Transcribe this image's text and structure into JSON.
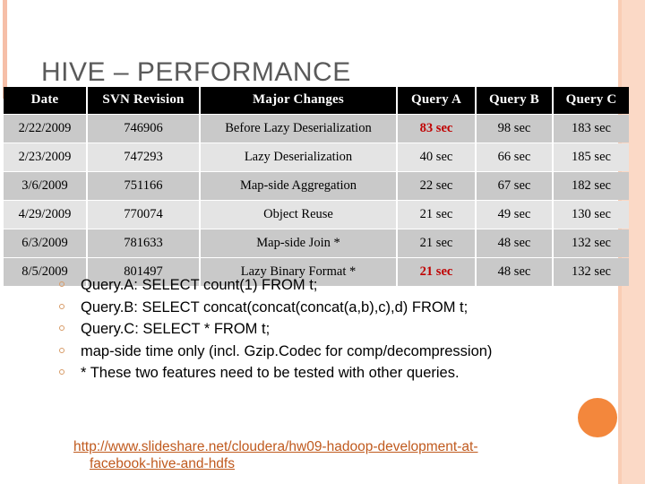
{
  "slide": {
    "title": "HIVE – PERFORMANCE"
  },
  "table": {
    "headers": [
      "Date",
      "SVN Revision",
      "Major Changes",
      "Query A",
      "Query B",
      "Query C"
    ],
    "rows": [
      {
        "date": "2/22/2009",
        "revision": "746906",
        "changes": "Before Lazy Deserialization",
        "query_a": "83 sec",
        "query_b": "98 sec",
        "query_c": "183 sec",
        "highlight_a": true
      },
      {
        "date": "2/23/2009",
        "revision": "747293",
        "changes": "Lazy Deserialization",
        "query_a": "40 sec",
        "query_b": "66 sec",
        "query_c": "185 sec",
        "highlight_a": false
      },
      {
        "date": "3/6/2009",
        "revision": "751166",
        "changes": "Map-side Aggregation",
        "query_a": "22 sec",
        "query_b": "67 sec",
        "query_c": "182 sec",
        "highlight_a": false
      },
      {
        "date": "4/29/2009",
        "revision": "770074",
        "changes": "Object Reuse",
        "query_a": "21 sec",
        "query_b": "49 sec",
        "query_c": "130 sec",
        "highlight_a": false
      },
      {
        "date": "6/3/2009",
        "revision": "781633",
        "changes": "Map-side Join *",
        "query_a": "21 sec",
        "query_b": "48 sec",
        "query_c": "132 sec",
        "highlight_a": false
      },
      {
        "date": "8/5/2009",
        "revision": "801497",
        "changes": "Lazy Binary Format *",
        "query_a": "21 sec",
        "query_b": "48 sec",
        "query_c": "132 sec",
        "highlight_a": true
      }
    ]
  },
  "bullets": [
    "Query.A: SELECT count(1) FROM t;",
    "Query.B: SELECT concat(concat(concat(a,b),c),d) FROM t;",
    "Query.C: SELECT * FROM t;",
    "map-side time only (incl. Gzip.Codec for comp/decompression)",
    "* These two features need to be tested with other queries."
  ],
  "link": {
    "line1": "http://www.slideshare.net/cloudera/hw09-hadoop-development-at-",
    "line2": "facebook-hive-and-hdfs"
  },
  "colors": {
    "accent_orange": "#f3873c",
    "frame_peach": "#fbd9c6",
    "link": "#c05a1e",
    "highlight_red": "#c00000",
    "header_bg": "#000000",
    "row_dark": "#c9c9c9",
    "row_light": "#e4e4e4"
  }
}
